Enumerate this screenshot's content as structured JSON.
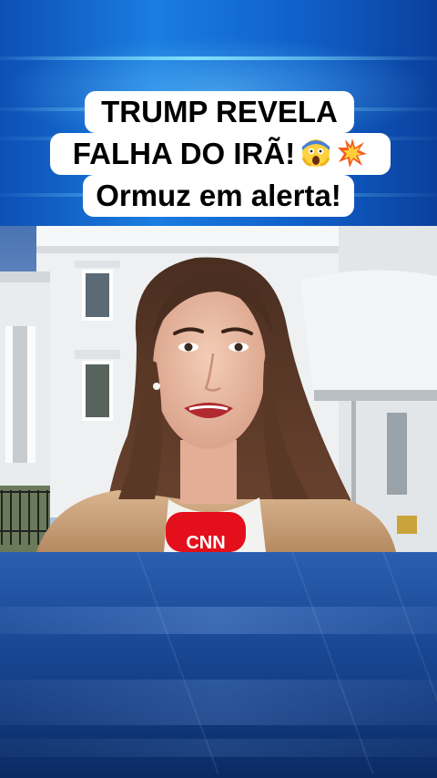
{
  "headline": {
    "line1": "TRUMP REVELA",
    "line2": "FALHA DO IRÃ!",
    "line3": "Ormuz em alerta!",
    "emojis": [
      "screaming-face-emoji",
      "collision-emoji"
    ]
  },
  "video": {
    "microphone_brand": "CNN",
    "microphone_color": "#e3101c"
  },
  "colors": {
    "background_blue": "#1a7de0",
    "caption_bg": "#ffffff",
    "caption_text": "#000000"
  }
}
